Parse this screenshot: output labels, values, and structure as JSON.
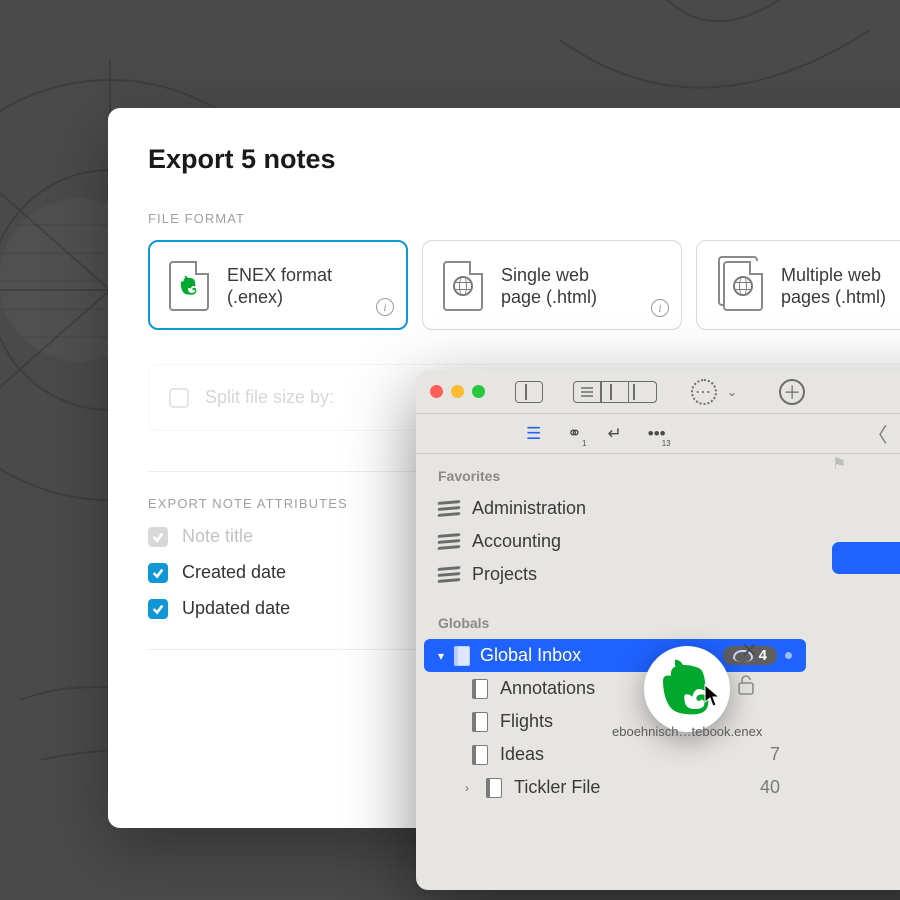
{
  "export": {
    "title": "Export 5 notes",
    "file_format_label": "FILE FORMAT",
    "formats": [
      {
        "label_l1": "ENEX format",
        "label_l2": "(.enex)",
        "selected": true
      },
      {
        "label_l1": "Single web",
        "label_l2": "page (.html)",
        "selected": false
      },
      {
        "label_l1": "Multiple web",
        "label_l2": "pages (.html)",
        "selected": false
      }
    ],
    "split": {
      "label": "Split file size by:"
    },
    "attr_section_label": "EXPORT NOTE ATTRIBUTES",
    "attributes": [
      {
        "label": "Note title",
        "checked": true,
        "disabled": true
      },
      {
        "label": "Created date",
        "checked": true,
        "disabled": false
      },
      {
        "label": "Updated date",
        "checked": true,
        "disabled": false
      }
    ]
  },
  "app": {
    "subtoolbar": {
      "badge1": "1",
      "badge2": "13"
    },
    "sidebar": {
      "favorites_label": "Favorites",
      "favorites": [
        "Administration",
        "Accounting",
        "Projects"
      ],
      "globals_label": "Globals",
      "globals": [
        {
          "label": "Global Inbox",
          "selected": true,
          "count_badge": "4"
        },
        {
          "label": "Annotations",
          "indent": true
        },
        {
          "label": "Flights",
          "indent": true
        },
        {
          "label": "Ideas",
          "indent": true,
          "count": "7"
        },
        {
          "label": "Tickler File",
          "indent": true,
          "count": "40",
          "expandable": true
        }
      ]
    },
    "drag_filename": "eboehnisch…tebook.enex"
  }
}
